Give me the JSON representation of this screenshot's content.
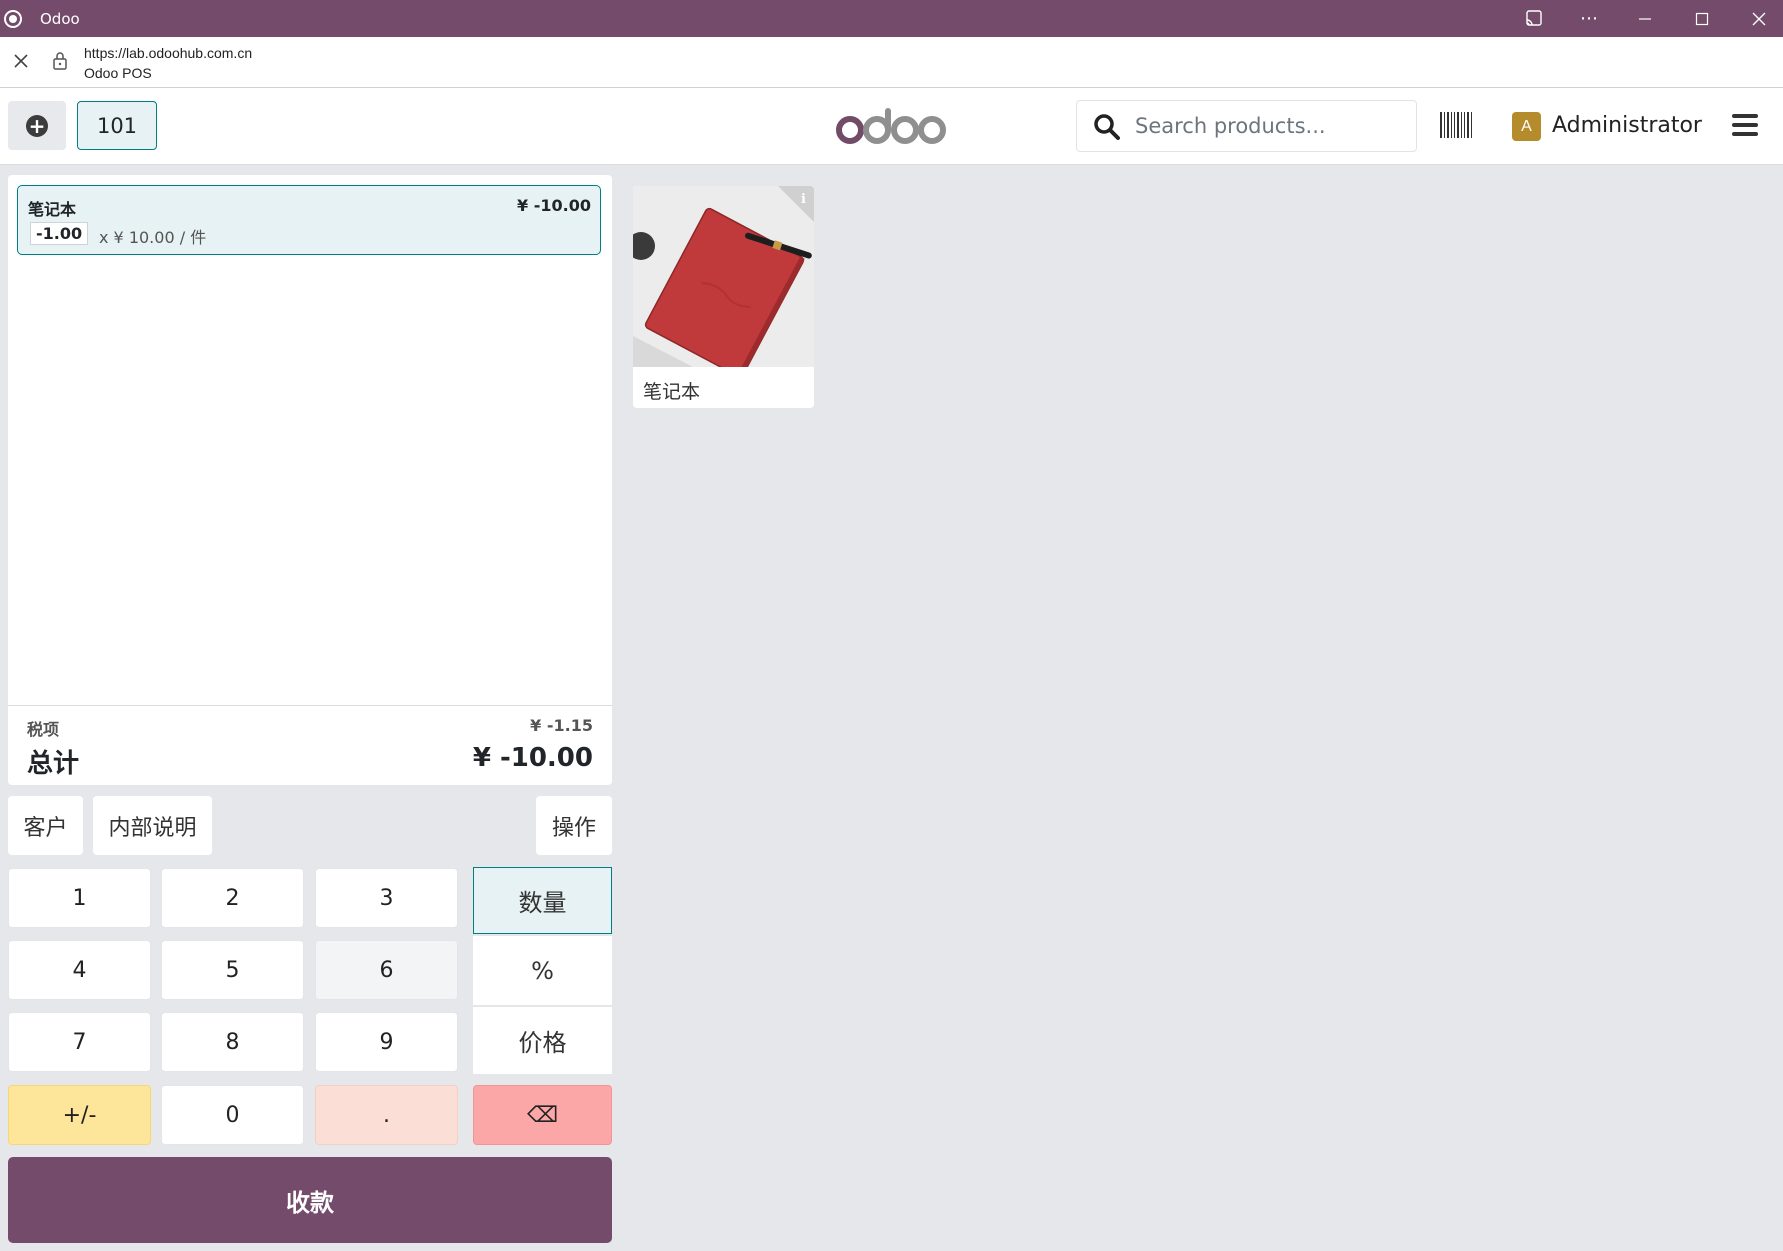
{
  "window": {
    "title": "Odoo",
    "controls": [
      "cast-icon",
      "more-icon",
      "minimize-icon",
      "maximize-icon",
      "close-icon"
    ]
  },
  "urlbar": {
    "url": "https://lab.odoohub.com.cn",
    "page_title": "Odoo POS"
  },
  "header": {
    "order_tab": "101",
    "logo": "odoo",
    "search_placeholder": "Search products...",
    "user_initial": "A",
    "user_name": "Administrator"
  },
  "order": {
    "lines": [
      {
        "name": "笔记本",
        "price": "¥ -10.00",
        "qty": "-1.00",
        "unit_price": "x ¥ 10.00 / 件"
      }
    ],
    "tax_label": "税项",
    "tax_value": "¥ -1.15",
    "total_label": "总计",
    "total_value": "¥ -10.00"
  },
  "controls": {
    "customer": "客户",
    "internal_note": "内部说明",
    "actions": "操作"
  },
  "numpad": {
    "keys": [
      "1",
      "2",
      "3",
      "4",
      "5",
      "6",
      "7",
      "8",
      "9",
      "+/-",
      "0",
      "."
    ],
    "backspace": "⌫",
    "modes": [
      "数量",
      "%",
      "价格"
    ],
    "active_mode": "数量"
  },
  "payment_label": "收款",
  "products": [
    {
      "name": "笔记本"
    }
  ],
  "colors": {
    "brand": "#744b6a",
    "accent": "#017e84",
    "plusminus": "#fde59a",
    "dot": "#fbded5",
    "backspace": "#fca7a7"
  }
}
